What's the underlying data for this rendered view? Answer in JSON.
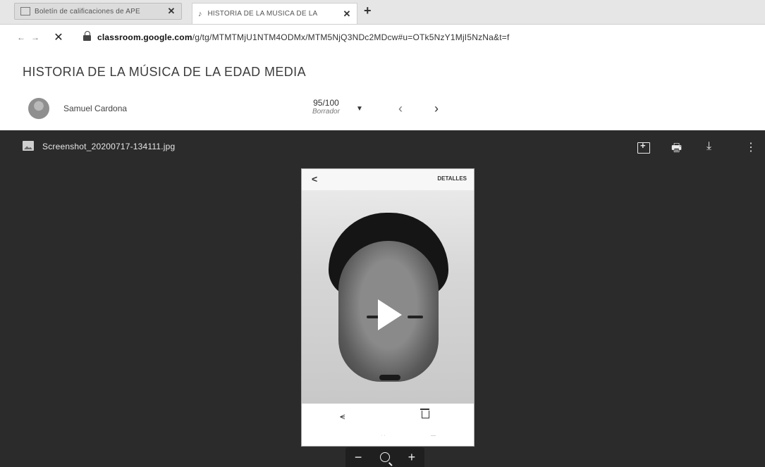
{
  "browser": {
    "tabs": [
      {
        "title": "Boletín de calificaciones de APE",
        "active": false
      },
      {
        "title": "HISTORIA DE LA MÚSICA DE LA",
        "active": true
      }
    ],
    "new_tab": "+",
    "url_domain": "classroom.google.com",
    "url_path": "/g/tg/MTMTMjU1NTM4ODMx/MTM5NjQ3NDc2MDcw#u=OTk5NzY1MjI5NzNa&t=f"
  },
  "page": {
    "title": "HISTORIA DE LA MÚSICA DE LA EDAD MEDIA"
  },
  "student": {
    "name": "Samuel Cardona",
    "grade": "95/100",
    "grade_status": "Borrador"
  },
  "viewer": {
    "file_name": "Screenshot_20200717-134111.jpg",
    "phone_top_action": "DETALLES",
    "phone_back": "<"
  },
  "icons": {
    "add_comment": "add-comment-icon",
    "print": "print-icon",
    "download": "download-icon",
    "more": "more-vert-icon"
  },
  "zoom": {
    "minus": "−",
    "plus": "+"
  },
  "colors": {
    "viewer_bg": "#2b2b2b",
    "page_bg": "#ffffff"
  }
}
